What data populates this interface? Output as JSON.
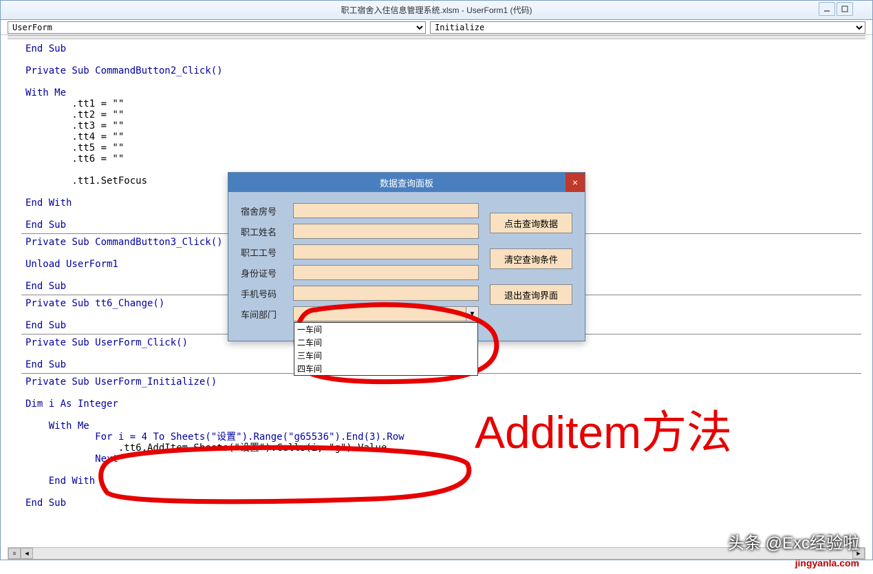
{
  "window": {
    "title": "职工宿舍入住信息管理系统.xlsm - UserForm1 (代码)"
  },
  "dropdowns": {
    "object": "UserForm",
    "procedure": "Initialize"
  },
  "code": {
    "lines": [
      {
        "t": "End Sub",
        "cls": "kw",
        "indent": 0
      },
      {
        "t": "",
        "cls": "",
        "indent": 0
      },
      {
        "t": "Private Sub CommandButton2_Click()",
        "cls": "kw",
        "indent": 0
      },
      {
        "t": "",
        "cls": "",
        "indent": 0
      },
      {
        "t": "With Me",
        "cls": "kw",
        "indent": 0
      },
      {
        "t": ".tt1 = \"\"",
        "cls": "",
        "indent": 8
      },
      {
        "t": ".tt2 = \"\"",
        "cls": "",
        "indent": 8
      },
      {
        "t": ".tt3 = \"\"",
        "cls": "",
        "indent": 8
      },
      {
        "t": ".tt4 = \"\"",
        "cls": "",
        "indent": 8
      },
      {
        "t": ".tt5 = \"\"",
        "cls": "",
        "indent": 8
      },
      {
        "t": ".tt6 = \"\"",
        "cls": "",
        "indent": 8
      },
      {
        "t": "",
        "cls": "",
        "indent": 0
      },
      {
        "t": ".tt1.SetFocus",
        "cls": "",
        "indent": 8
      },
      {
        "t": "",
        "cls": "",
        "indent": 0
      },
      {
        "t": "End With",
        "cls": "kw",
        "indent": 0
      },
      {
        "t": "",
        "cls": "",
        "indent": 0
      },
      {
        "t": "End Sub",
        "cls": "kw",
        "indent": 0
      },
      {
        "t": "",
        "cls": "",
        "indent": 0,
        "rule": true
      },
      {
        "t": "Private Sub CommandButton3_Click()",
        "cls": "kw",
        "indent": 0
      },
      {
        "t": "",
        "cls": "",
        "indent": 0
      },
      {
        "t": "Unload UserForm1",
        "cls": "kw",
        "indent": 0
      },
      {
        "t": "",
        "cls": "",
        "indent": 0
      },
      {
        "t": "End Sub",
        "cls": "kw",
        "indent": 0
      },
      {
        "t": "",
        "cls": "",
        "indent": 0,
        "rule": true
      },
      {
        "t": "Private Sub tt6_Change()",
        "cls": "kw",
        "indent": 0
      },
      {
        "t": "",
        "cls": "",
        "indent": 0
      },
      {
        "t": "End Sub",
        "cls": "kw",
        "indent": 0
      },
      {
        "t": "",
        "cls": "",
        "indent": 0,
        "rule": true
      },
      {
        "t": "Private Sub UserForm_Click()",
        "cls": "kw",
        "indent": 0
      },
      {
        "t": "",
        "cls": "",
        "indent": 0
      },
      {
        "t": "End Sub",
        "cls": "kw",
        "indent": 0
      },
      {
        "t": "",
        "cls": "",
        "indent": 0,
        "rule": true
      },
      {
        "t": "Private Sub UserForm_Initialize()",
        "cls": "kw",
        "indent": 0
      },
      {
        "t": "",
        "cls": "",
        "indent": 0
      },
      {
        "t": "Dim i As Integer",
        "cls": "kw",
        "indent": 0
      },
      {
        "t": "",
        "cls": "",
        "indent": 0
      },
      {
        "t": "With Me",
        "cls": "kw",
        "indent": 4
      },
      {
        "t": "For i = 4 To Sheets(\"设置\").Range(\"g65536\").End(3).Row",
        "cls": "kw",
        "indent": 12
      },
      {
        "t": ".tt6.AddItem Sheets(\"设置\").Cells(i, \"g\").Value",
        "cls": "",
        "indent": 16
      },
      {
        "t": "Next",
        "cls": "kw",
        "indent": 12
      },
      {
        "t": "",
        "cls": "",
        "indent": 0
      },
      {
        "t": "End With",
        "cls": "kw",
        "indent": 4
      },
      {
        "t": "",
        "cls": "",
        "indent": 0
      },
      {
        "t": "End Sub",
        "cls": "kw",
        "indent": 0
      }
    ]
  },
  "dialog": {
    "title": "数据查询面板",
    "close": "×",
    "fields": {
      "room": "宿舍房号",
      "name": "职工姓名",
      "empno": "职工工号",
      "idno": "身份证号",
      "phone": "手机号码",
      "dept": "车间部门"
    },
    "combo_options": [
      "一车间",
      "二车间",
      "三车间",
      "四车间"
    ],
    "buttons": {
      "query": "点击查询数据",
      "clear": "清空查询条件",
      "exit": "退出查询界面"
    }
  },
  "annotations": {
    "big_text": "Additem方法"
  },
  "watermarks": {
    "top": "头条 @Exc经验啦",
    "bottom": "jingyanla.com"
  }
}
